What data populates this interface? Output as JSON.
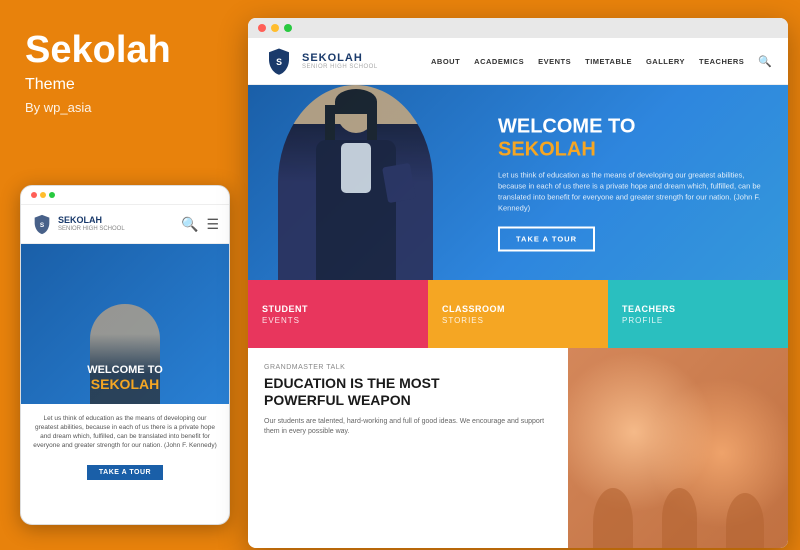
{
  "left_panel": {
    "brand_name": "Sekolah",
    "brand_type": "Theme",
    "author": "By wp_asia"
  },
  "mobile": {
    "logo_main": "SEKOLAH",
    "logo_sub": "SENIOR HIGH SCHOOL",
    "welcome_line1": "WELCOME TO",
    "welcome_brand": "SEKOLAH",
    "description": "Let us think of education as the means of developing our greatest abilities, because in each of us there is a private hope and dream which, fulfilled, can be translated into benefit for everyone and greater strength for our nation. (John F. Kennedy)",
    "cta_button": "TAKE A TOUR"
  },
  "desktop": {
    "nav": {
      "logo_main": "SEKOLAH",
      "logo_sub": "SENIOR HIGH SCHOOL",
      "links": [
        "ABOUT",
        "ACADEMICS",
        "EVENTS",
        "TIMETABLE",
        "GALLERY",
        "TEACHERS"
      ]
    },
    "hero": {
      "welcome_line1": "WELCOME TO",
      "welcome_brand": "SEKOLAH",
      "description": "Let us think of education as the means of developing our greatest abilities, because in each of us there is a private hope and dream which, fulfilled, can be translated into benefit for everyone and greater strength for our nation. (John F. Kennedy)",
      "cta_button": "TAKE A TOUR"
    },
    "features": [
      {
        "title": "STUDENT",
        "subtitle": "EVENTS",
        "color": "pink"
      },
      {
        "title": "CLASSROOM",
        "subtitle": "STORIES",
        "color": "orange"
      },
      {
        "title": "TEACHERS",
        "subtitle": "PROFILE",
        "color": "teal"
      }
    ],
    "content": {
      "tag": "Grandmaster Talk",
      "headline_line1": "EDUCATION IS THE MOST",
      "headline_line2": "POWERFUL WEAPON",
      "body": "Our students are talented, hard-working and full of good ideas. We encourage and support them in every possible way."
    }
  },
  "colors": {
    "orange": "#E8820C",
    "blue": "#1a5fa8",
    "pink": "#e8365d",
    "teal": "#2abfbf",
    "gold": "#f5a623"
  }
}
